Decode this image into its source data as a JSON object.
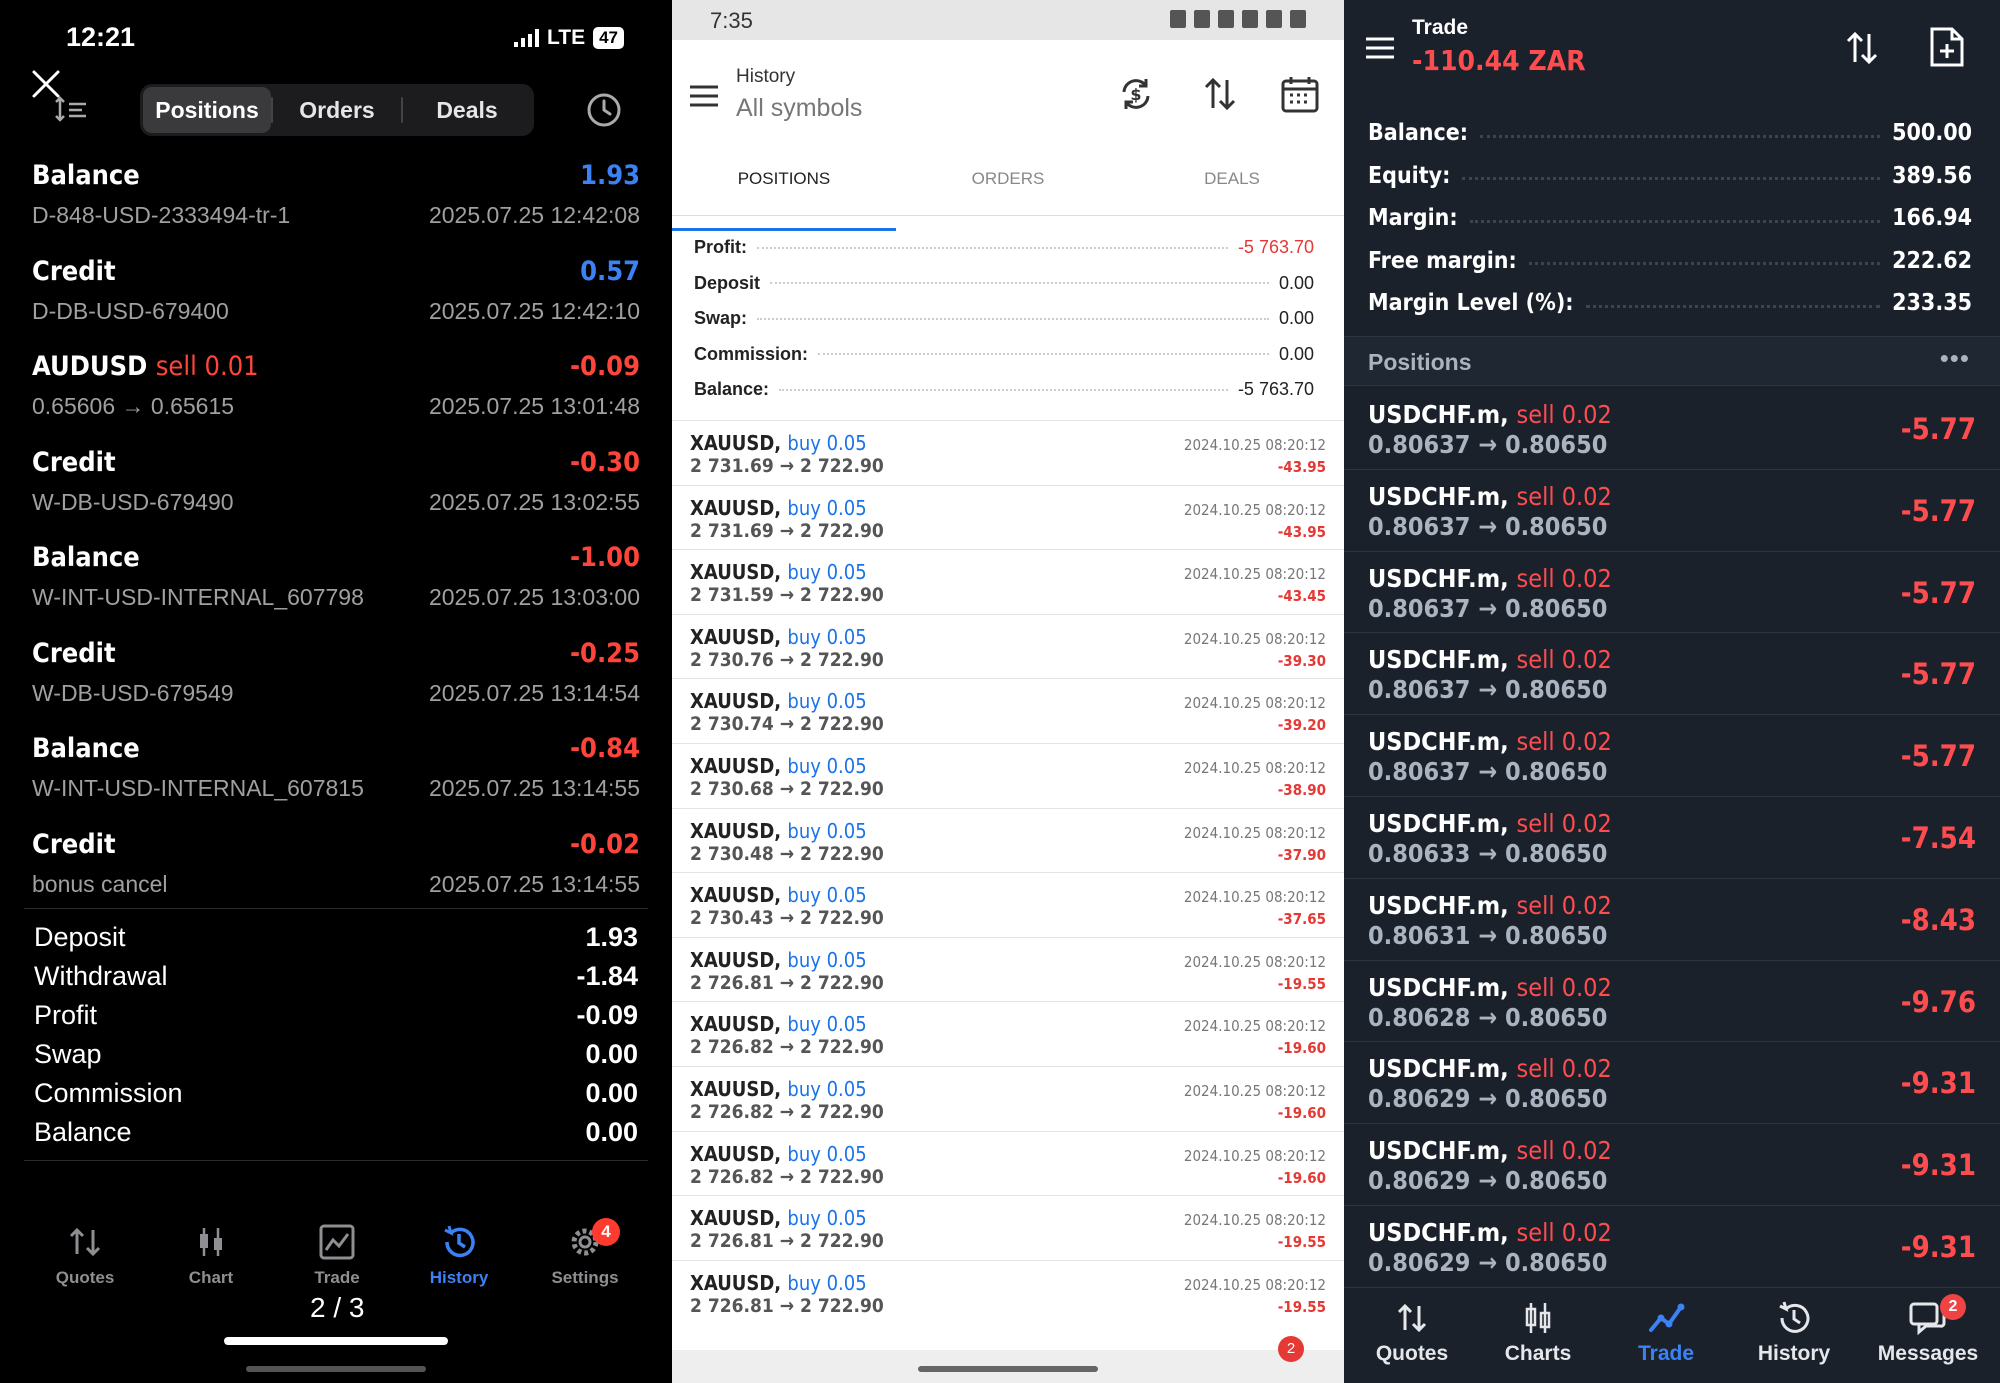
{
  "panel1": {
    "status": {
      "time": "12:21",
      "network": "LTE",
      "battery": "47"
    },
    "segments": [
      {
        "label": "Positions",
        "active": true
      },
      {
        "label": "Orders",
        "active": false
      },
      {
        "label": "Deals",
        "active": false
      }
    ],
    "rows": [
      {
        "title": "Balance",
        "side": "",
        "amount": "1.93",
        "sign": "pos",
        "sub": "D-848-USD-2333494-tr-1",
        "date": "2025.07.25 12:42:08"
      },
      {
        "title": "Credit",
        "side": "",
        "amount": "0.57",
        "sign": "pos",
        "sub": "D-DB-USD-679400",
        "date": "2025.07.25 12:42:10"
      },
      {
        "title": "AUDUSD",
        "side": "sell 0.01",
        "amount": "-0.09",
        "sign": "neg",
        "sub": "0.65606 → 0.65615",
        "date": "2025.07.25 13:01:48"
      },
      {
        "title": "Credit",
        "side": "",
        "amount": "-0.30",
        "sign": "neg",
        "sub": "W-DB-USD-679490",
        "date": "2025.07.25 13:02:55"
      },
      {
        "title": "Balance",
        "side": "",
        "amount": "-1.00",
        "sign": "neg",
        "sub": "W-INT-USD-INTERNAL_607798",
        "date": "2025.07.25 13:03:00"
      },
      {
        "title": "Credit",
        "side": "",
        "amount": "-0.25",
        "sign": "neg",
        "sub": "W-DB-USD-679549",
        "date": "2025.07.25 13:14:54"
      },
      {
        "title": "Balance",
        "side": "",
        "amount": "-0.84",
        "sign": "neg",
        "sub": "W-INT-USD-INTERNAL_607815",
        "date": "2025.07.25 13:14:55"
      },
      {
        "title": "Credit",
        "side": "",
        "amount": "-0.02",
        "sign": "neg",
        "sub": "bonus cancel",
        "date": "2025.07.25 13:14:55"
      }
    ],
    "summary": [
      {
        "label": "Deposit",
        "value": "1.93"
      },
      {
        "label": "Withdrawal",
        "value": "-1.84"
      },
      {
        "label": "Profit",
        "value": "-0.09"
      },
      {
        "label": "Swap",
        "value": "0.00"
      },
      {
        "label": "Commission",
        "value": "0.00"
      },
      {
        "label": "Balance",
        "value": "0.00"
      }
    ],
    "tabs": [
      {
        "label": "Quotes",
        "icon": "quotes-icon",
        "active": false
      },
      {
        "label": "Chart",
        "icon": "chart-icon",
        "active": false
      },
      {
        "label": "Trade",
        "icon": "trade-icon",
        "active": false
      },
      {
        "label": "History",
        "icon": "history-icon",
        "active": true
      },
      {
        "label": "Settings",
        "icon": "settings-icon",
        "active": false
      }
    ],
    "settings_badge": "4",
    "page_indicator": "2 / 3"
  },
  "panel2": {
    "status": {
      "time": "7:35"
    },
    "header": {
      "title": "History",
      "subtitle": "All symbols"
    },
    "tabs": [
      {
        "label": "POSITIONS",
        "active": true
      },
      {
        "label": "ORDERS",
        "active": false
      },
      {
        "label": "DEALS",
        "active": false
      }
    ],
    "summary": [
      {
        "label": "Profit:",
        "value": "-5 763.70",
        "red": true
      },
      {
        "label": "Deposit",
        "value": "0.00",
        "red": false
      },
      {
        "label": "Swap:",
        "value": "0.00",
        "red": false
      },
      {
        "label": "Commission:",
        "value": "0.00",
        "red": false
      },
      {
        "label": "Balance:",
        "value": "-5 763.70",
        "red": false
      }
    ],
    "items": [
      {
        "symbol": "XAUUSD,",
        "side": "buy 0.05",
        "prices": "2 731.69 → 2 722.90",
        "date": "2024.10.25 08:20:12",
        "pl": "-43.95"
      },
      {
        "symbol": "XAUUSD,",
        "side": "buy 0.05",
        "prices": "2 731.69 → 2 722.90",
        "date": "2024.10.25 08:20:12",
        "pl": "-43.95"
      },
      {
        "symbol": "XAUUSD,",
        "side": "buy 0.05",
        "prices": "2 731.59 → 2 722.90",
        "date": "2024.10.25 08:20:12",
        "pl": "-43.45"
      },
      {
        "symbol": "XAUUSD,",
        "side": "buy 0.05",
        "prices": "2 730.76 → 2 722.90",
        "date": "2024.10.25 08:20:12",
        "pl": "-39.30"
      },
      {
        "symbol": "XAUUSD,",
        "side": "buy 0.05",
        "prices": "2 730.74 → 2 722.90",
        "date": "2024.10.25 08:20:12",
        "pl": "-39.20"
      },
      {
        "symbol": "XAUUSD,",
        "side": "buy 0.05",
        "prices": "2 730.68 → 2 722.90",
        "date": "2024.10.25 08:20:12",
        "pl": "-38.90"
      },
      {
        "symbol": "XAUUSD,",
        "side": "buy 0.05",
        "prices": "2 730.48 → 2 722.90",
        "date": "2024.10.25 08:20:12",
        "pl": "-37.90"
      },
      {
        "symbol": "XAUUSD,",
        "side": "buy 0.05",
        "prices": "2 730.43 → 2 722.90",
        "date": "2024.10.25 08:20:12",
        "pl": "-37.65"
      },
      {
        "symbol": "XAUUSD,",
        "side": "buy 0.05",
        "prices": "2 726.81 → 2 722.90",
        "date": "2024.10.25 08:20:12",
        "pl": "-19.55"
      },
      {
        "symbol": "XAUUSD,",
        "side": "buy 0.05",
        "prices": "2 726.82 → 2 722.90",
        "date": "2024.10.25 08:20:12",
        "pl": "-19.60"
      },
      {
        "symbol": "XAUUSD,",
        "side": "buy 0.05",
        "prices": "2 726.82 → 2 722.90",
        "date": "2024.10.25 08:20:12",
        "pl": "-19.60"
      },
      {
        "symbol": "XAUUSD,",
        "side": "buy 0.05",
        "prices": "2 726.82 → 2 722.90",
        "date": "2024.10.25 08:20:12",
        "pl": "-19.60"
      },
      {
        "symbol": "XAUUSD,",
        "side": "buy 0.05",
        "prices": "2 726.81 → 2 722.90",
        "date": "2024.10.25 08:20:12",
        "pl": "-19.55"
      },
      {
        "symbol": "XAUUSD,",
        "side": "buy 0.05",
        "prices": "2 726.81 → 2 722.90",
        "date": "2024.10.25 08:20:12",
        "pl": "-19.55"
      }
    ],
    "badge": "2"
  },
  "panel3": {
    "header": {
      "title": "Trade",
      "value": "-110.44 ZAR"
    },
    "account": [
      {
        "label": "Balance:",
        "value": "500.00"
      },
      {
        "label": "Equity:",
        "value": "389.56"
      },
      {
        "label": "Margin:",
        "value": "166.94"
      },
      {
        "label": "Free margin:",
        "value": "222.62"
      },
      {
        "label": "Margin Level (%):",
        "value": "233.35"
      }
    ],
    "positions_label": "Positions",
    "more": "•••",
    "positions": [
      {
        "symbol": "USDCHF.m,",
        "side": "sell 0.02",
        "prices": "0.80637 → 0.80650",
        "pl": "-5.77"
      },
      {
        "symbol": "USDCHF.m,",
        "side": "sell 0.02",
        "prices": "0.80637 → 0.80650",
        "pl": "-5.77"
      },
      {
        "symbol": "USDCHF.m,",
        "side": "sell 0.02",
        "prices": "0.80637 → 0.80650",
        "pl": "-5.77"
      },
      {
        "symbol": "USDCHF.m,",
        "side": "sell 0.02",
        "prices": "0.80637 → 0.80650",
        "pl": "-5.77"
      },
      {
        "symbol": "USDCHF.m,",
        "side": "sell 0.02",
        "prices": "0.80637 → 0.80650",
        "pl": "-5.77"
      },
      {
        "symbol": "USDCHF.m,",
        "side": "sell 0.02",
        "prices": "0.80633 → 0.80650",
        "pl": "-7.54"
      },
      {
        "symbol": "USDCHF.m,",
        "side": "sell 0.02",
        "prices": "0.80631 → 0.80650",
        "pl": "-8.43"
      },
      {
        "symbol": "USDCHF.m,",
        "side": "sell 0.02",
        "prices": "0.80628 → 0.80650",
        "pl": "-9.76"
      },
      {
        "symbol": "USDCHF.m,",
        "side": "sell 0.02",
        "prices": "0.80629 → 0.80650",
        "pl": "-9.31"
      },
      {
        "symbol": "USDCHF.m,",
        "side": "sell 0.02",
        "prices": "0.80629 → 0.80650",
        "pl": "-9.31"
      },
      {
        "symbol": "USDCHF.m,",
        "side": "sell 0.02",
        "prices": "0.80629 → 0.80650",
        "pl": "-9.31"
      }
    ],
    "nav": [
      {
        "label": "Quotes",
        "icon": "quotes-icon",
        "active": false
      },
      {
        "label": "Charts",
        "icon": "charts-icon",
        "active": false
      },
      {
        "label": "Trade",
        "icon": "trade-icon",
        "active": true
      },
      {
        "label": "History",
        "icon": "history-icon",
        "active": false
      },
      {
        "label": "Messages",
        "icon": "messages-icon",
        "active": false
      }
    ],
    "messages_badge": "2"
  }
}
